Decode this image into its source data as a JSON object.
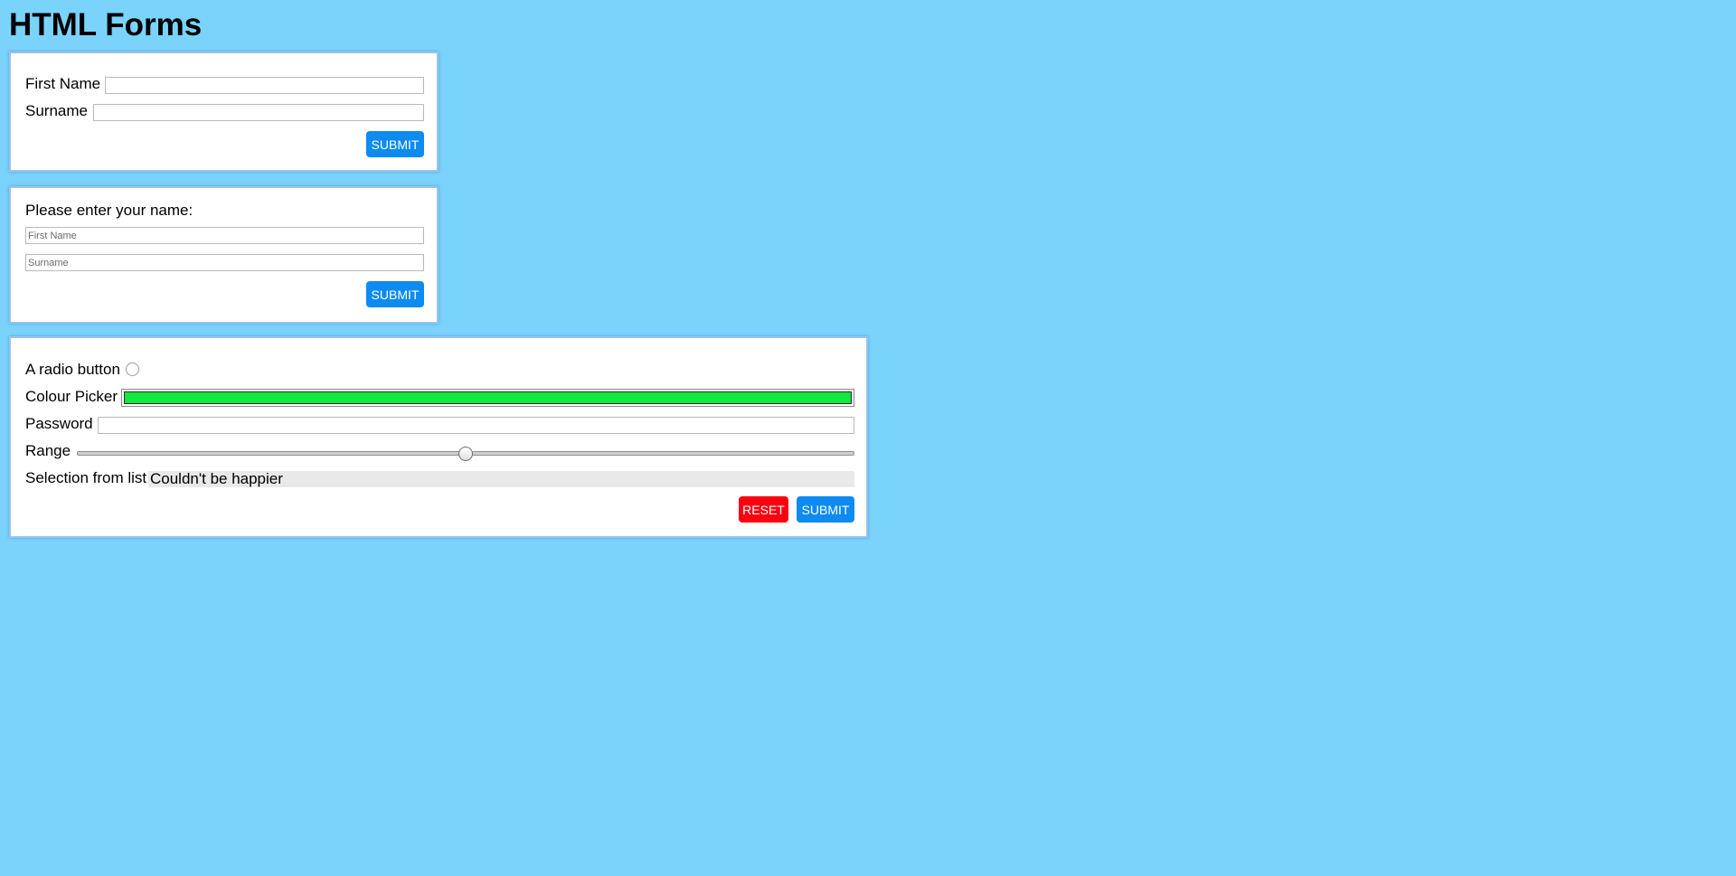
{
  "page": {
    "title": "HTML Forms"
  },
  "form1": {
    "first_name_label": "First Name",
    "first_name_value": "",
    "surname_label": "Surname",
    "surname_value": "",
    "submit_label": "SUBMIT"
  },
  "form2": {
    "prompt": "Please enter your name:",
    "first_name_placeholder": "First Name",
    "surname_placeholder": "Surname",
    "submit_label": "SUBMIT"
  },
  "form3": {
    "radio_label": "A radio button",
    "radio_checked": false,
    "colour_label": "Colour Picker",
    "colour_value": "#13e83e",
    "password_label": "Password",
    "password_value": "",
    "range_label": "Range",
    "range_value_fraction": 0.5,
    "select_label": "Selection from list",
    "select_value": "Couldn't be happier",
    "reset_label": "RESET",
    "submit_label": "SUBMIT"
  },
  "colors": {
    "background": "#7ad3fb",
    "submit_button": "#0d8bf0",
    "reset_button": "#fd0010"
  }
}
